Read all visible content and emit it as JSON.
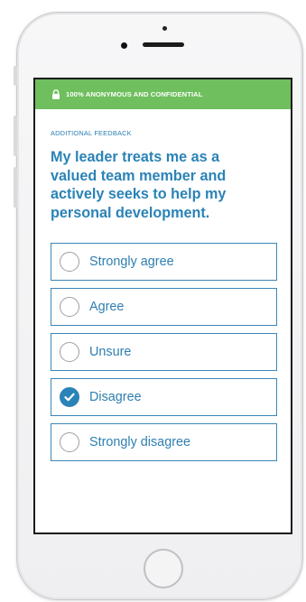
{
  "banner": {
    "text": "100% ANONYMOUS AND CONFIDENTIAL",
    "icon": "lock-icon",
    "color": "#6fbf5e"
  },
  "survey": {
    "section_label": "ADDITIONAL FEEDBACK",
    "question": "My leader treats me as a valued team member and actively seeks to help my personal development.",
    "options": [
      {
        "label": "Strongly agree",
        "selected": false
      },
      {
        "label": "Agree",
        "selected": false
      },
      {
        "label": "Unsure",
        "selected": false
      },
      {
        "label": "Disagree",
        "selected": true
      },
      {
        "label": "Strongly disagree",
        "selected": false
      }
    ]
  },
  "colors": {
    "accent": "#2a83b6",
    "banner": "#6fbf5e"
  }
}
